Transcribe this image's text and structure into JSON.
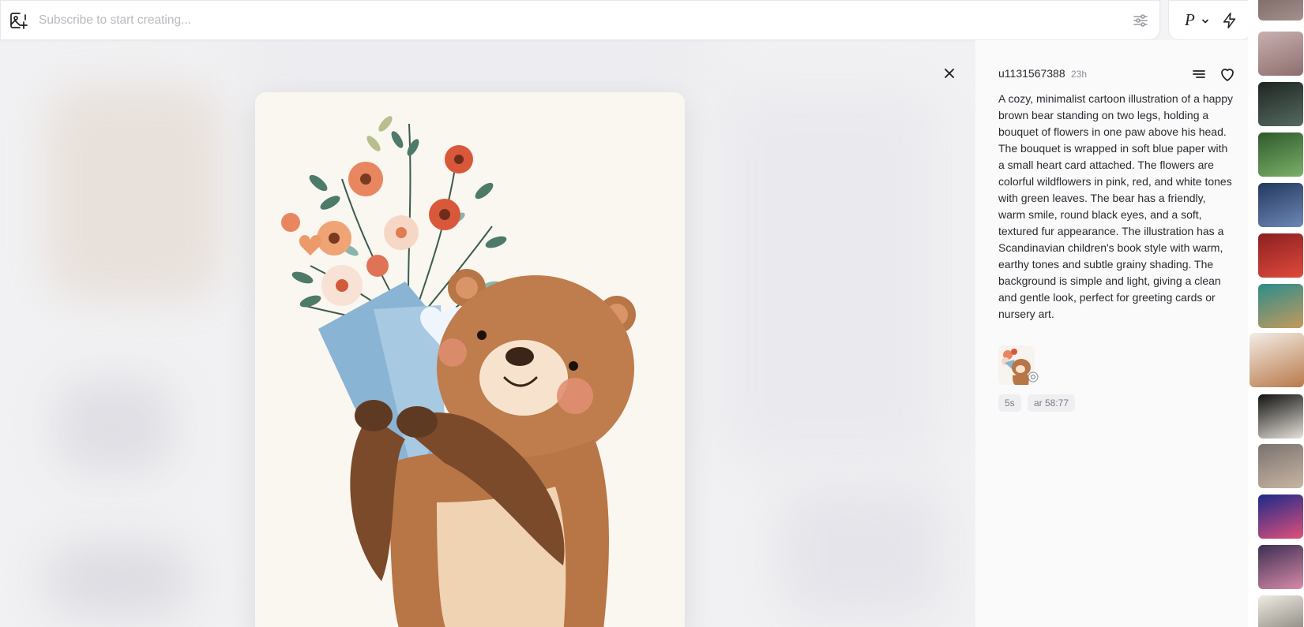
{
  "search": {
    "placeholder": "Subscribe to start creating..."
  },
  "mode": {
    "label": "P"
  },
  "post": {
    "username": "u1131567388",
    "time_ago": "23h",
    "prompt": "A cozy, minimalist cartoon illustration of a happy brown bear standing on two legs, holding a bouquet of flowers in one paw above his head. The bouquet is wrapped in soft blue paper with a small heart card attached. The flowers are colorful wildflowers in pink, red, and white tones with green leaves. The bear has a friendly, warm smile, round black eyes, and a soft, textured fur appearance. The illustration has a Scandinavian children's book style with warm, earthy tones and subtle grainy shading. The background is simple and light, giving a clean and gentle look, perfect for greeting cards or nursery art.",
    "params": [
      "5s",
      "ar 58:77"
    ]
  },
  "thumbnails": [
    {
      "name": "thumb-street-scene",
      "colors": [
        "#6b5a58",
        "#a48f8c"
      ]
    },
    {
      "name": "thumb-girl-portrait",
      "colors": [
        "#c9b0b0",
        "#8d6e6e"
      ]
    },
    {
      "name": "thumb-night-road",
      "colors": [
        "#1e2522",
        "#556b60"
      ]
    },
    {
      "name": "thumb-green-room",
      "colors": [
        "#2f5a2c",
        "#7bb06a"
      ]
    },
    {
      "name": "thumb-city-lights",
      "colors": [
        "#24385e",
        "#6d88b6"
      ]
    },
    {
      "name": "thumb-red-hair-woman",
      "colors": [
        "#8a1f22",
        "#e04a3a"
      ]
    },
    {
      "name": "thumb-guitar-player",
      "colors": [
        "#2d8c8a",
        "#c49a5c"
      ]
    },
    {
      "name": "thumb-bear-bouquet",
      "colors": [
        "#f3ede6",
        "#b8794a"
      ]
    },
    {
      "name": "thumb-white-dog",
      "colors": [
        "#111111",
        "#e6e1d8"
      ]
    },
    {
      "name": "thumb-cat-selfie",
      "colors": [
        "#7a7270",
        "#c9b6a2"
      ]
    },
    {
      "name": "thumb-neon-face",
      "colors": [
        "#1b2a88",
        "#e0507a"
      ]
    },
    {
      "name": "thumb-pink-sky",
      "colors": [
        "#3c2f52",
        "#d88aa8"
      ]
    },
    {
      "name": "thumb-cute-cat",
      "colors": [
        "#efeae2",
        "#7f7a72"
      ]
    }
  ],
  "colors": {
    "accent_bear": "#b87545",
    "wrap_blue": "#8ab4d3",
    "panel_bg": "#fafafb"
  }
}
